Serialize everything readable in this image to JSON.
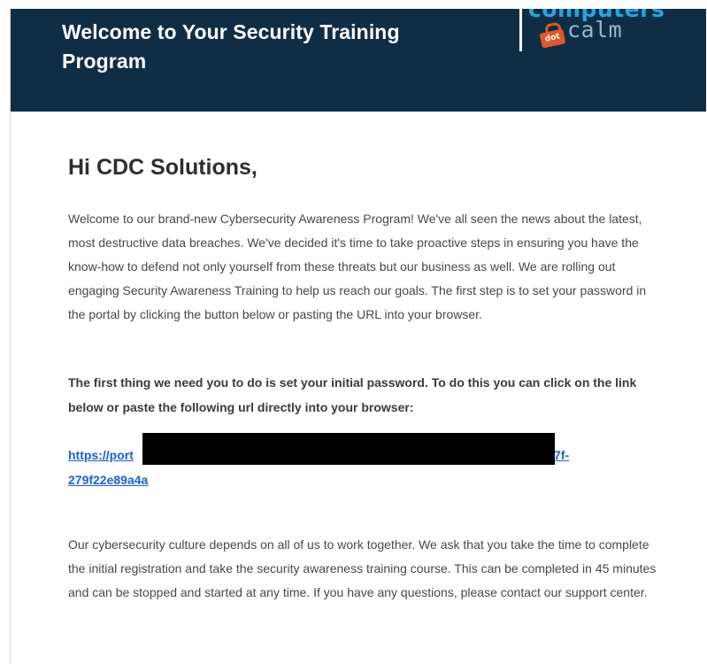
{
  "header": {
    "title": "Welcome to Your Security Training Program"
  },
  "logo": {
    "text_top": "computers",
    "text_badge": "dot",
    "text_bottom": "calm",
    "color_top": "#29a3e0",
    "color_badge": "#e2572b",
    "color_bottom": "#9ab6c8"
  },
  "email": {
    "greeting": "Hi CDC Solutions,",
    "paragraph_1": "Welcome to our brand-new Cybersecurity Awareness Program! We've all seen the news about the latest, most destructive data breaches. We've decided it's time to take proactive steps in ensuring you have the know-how to defend not only yourself from these threats but our business as well. We are rolling out engaging Security Awareness Training to help us reach our goals. The first step is to set your password in the portal by clicking the button below or pasting the URL into your browser.",
    "paragraph_2": "The first thing we need you to do is set your initial password. To do this you can click on the link below or paste the following url directly into your browser:",
    "link": {
      "visible_start": "https://port",
      "visible_middle": "7f-",
      "visible_end": "279f22e89a4a",
      "redacted": true
    },
    "paragraph_3": "Our cybersecurity culture depends on all of us to work together. We ask that you take the time to complete the initial registration and take the security awareness training course. This can be completed in 45 minutes and can be stopped and started at any time. If you have any questions, please contact our support center."
  },
  "colors": {
    "header_background": "#0f2e46",
    "link": "#1a5fd6",
    "redaction": "#000000"
  }
}
